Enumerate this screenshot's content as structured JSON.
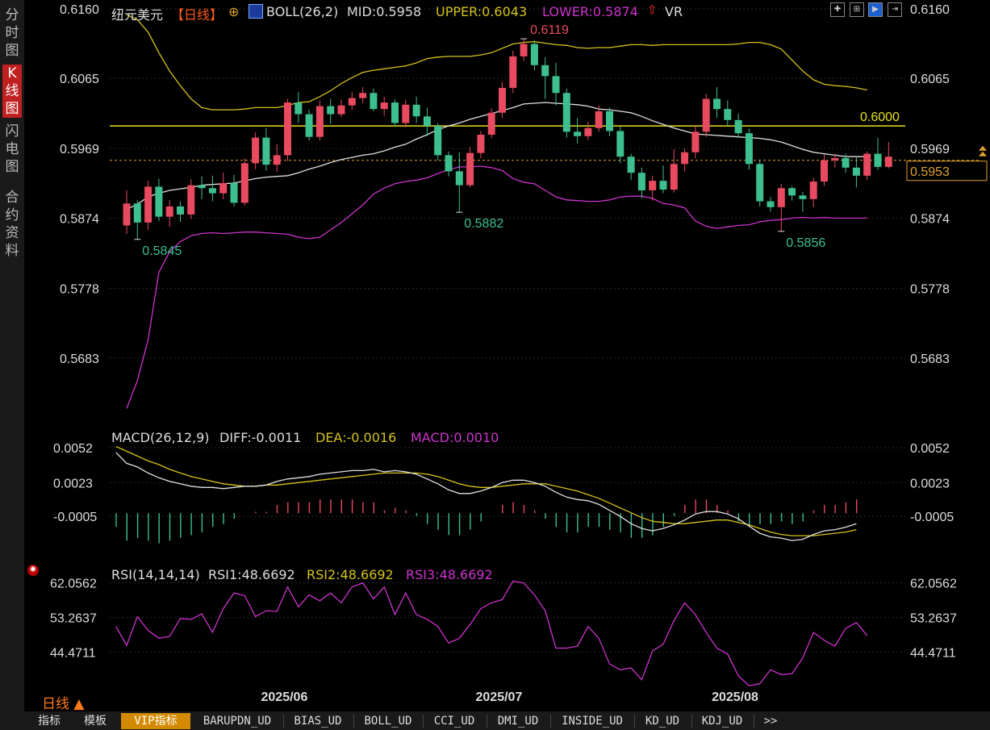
{
  "sidebar": {
    "items": [
      {
        "label": "分时图",
        "active": false
      },
      {
        "label": "K线图",
        "active": true
      },
      {
        "label": "闪电图",
        "active": false
      },
      {
        "label": "合约资料",
        "active": false
      }
    ]
  },
  "header": {
    "instrument": "纽元美元",
    "period": "【日线】",
    "add_icon": "⊕",
    "indicator": "BOLL(26,2)",
    "mid": "MID:0.5958",
    "upper": "UPPER:0.6043",
    "lower": "LOWER:0.5874",
    "vr": "VR"
  },
  "macd_header": {
    "name": "MACD(26,12,9)",
    "diff": "DIFF:-0.0011",
    "dea": "DEA:-0.0016",
    "macd": "MACD:0.0010"
  },
  "rsi_header": {
    "name": "RSI(14,14,14)",
    "rsi1": "RSI1:48.6692",
    "rsi2": "RSI2:48.6692",
    "rsi3": "RSI3:48.6692"
  },
  "period_label": "日线 ▲",
  "tabs": [
    "指标",
    "模板",
    "VIP指标",
    "BARUPDN_UD",
    "BIAS_UD",
    "BOLL_UD",
    "CCI_UD",
    "DMI_UD",
    "INSIDE_UD",
    "KD_UD",
    "KDJ_UD",
    ">>"
  ],
  "colors": {
    "up": "#e84a5f",
    "down": "#3dbf8f",
    "upper": "#d4c21a",
    "mid": "#e0e0e0",
    "lower": "#cc33cc",
    "hline": "#e8e020",
    "price_line": "#e0a030"
  },
  "chart_data": [
    {
      "type": "candlestick",
      "title": "纽元美元【日线】",
      "y_ticks": [
        "0.6160",
        "0.6065",
        "0.5969",
        "0.5874",
        "0.5778",
        "0.5683"
      ],
      "ylim": [
        0.5588,
        0.6172
      ],
      "x_labels": [
        "2025/06",
        "2025/07",
        "2025/08"
      ],
      "x_label_index": [
        15,
        35,
        57
      ],
      "annotations": {
        "high": "0.6119",
        "lows": [
          "0.5845",
          "0.5882",
          "0.5856"
        ],
        "hline": "0.6000",
        "last_price": "0.5953"
      },
      "hline": 0.6,
      "last_price": 0.5953,
      "candles": [
        [
          0.5864,
          0.5894,
          0.5912,
          0.5852
        ],
        [
          0.5894,
          0.5868,
          0.5899,
          0.5845
        ],
        [
          0.5868,
          0.5917,
          0.5925,
          0.5858
        ],
        [
          0.5917,
          0.5876,
          0.5928,
          0.587
        ],
        [
          0.5876,
          0.589,
          0.5899,
          0.5862
        ],
        [
          0.589,
          0.5879,
          0.5897,
          0.5869
        ],
        [
          0.5879,
          0.5919,
          0.5927,
          0.5873
        ],
        [
          0.5919,
          0.5915,
          0.5931,
          0.59
        ],
        [
          0.5915,
          0.5908,
          0.5932,
          0.5897
        ],
        [
          0.5908,
          0.5922,
          0.5936,
          0.59
        ],
        [
          0.5922,
          0.5895,
          0.5933,
          0.589
        ],
        [
          0.5895,
          0.5949,
          0.5956,
          0.5891
        ],
        [
          0.5949,
          0.5984,
          0.5991,
          0.5941
        ],
        [
          0.5984,
          0.5947,
          0.5997,
          0.5939
        ],
        [
          0.5947,
          0.596,
          0.5975,
          0.5937
        ],
        [
          0.596,
          0.6032,
          0.6037,
          0.5952
        ],
        [
          0.6032,
          0.6016,
          0.6046,
          0.6004
        ],
        [
          0.6016,
          0.5985,
          0.6022,
          0.598
        ],
        [
          0.5985,
          0.6027,
          0.6035,
          0.598
        ],
        [
          0.6027,
          0.6016,
          0.6037,
          0.6003
        ],
        [
          0.6016,
          0.6028,
          0.6036,
          0.6012
        ],
        [
          0.6028,
          0.6038,
          0.6046,
          0.6022
        ],
        [
          0.6038,
          0.6045,
          0.6053,
          0.6031
        ],
        [
          0.6045,
          0.6023,
          0.6051,
          0.602
        ],
        [
          0.6023,
          0.6032,
          0.604,
          0.6014
        ],
        [
          0.6032,
          0.6004,
          0.6036,
          0.5999
        ],
        [
          0.6004,
          0.6029,
          0.6036,
          0.5998
        ],
        [
          0.6029,
          0.6013,
          0.604,
          0.6004
        ],
        [
          0.6013,
          0.6,
          0.6025,
          0.5986
        ],
        [
          0.6,
          0.596,
          0.6004,
          0.5953
        ],
        [
          0.596,
          0.5938,
          0.5965,
          0.5931
        ],
        [
          0.5938,
          0.5919,
          0.5964,
          0.5882
        ],
        [
          0.5919,
          0.5963,
          0.5971,
          0.5916
        ],
        [
          0.5963,
          0.5988,
          0.5993,
          0.5956
        ],
        [
          0.5988,
          0.6018,
          0.6024,
          0.5983
        ],
        [
          0.6018,
          0.6052,
          0.606,
          0.6011
        ],
        [
          0.6052,
          0.6095,
          0.6103,
          0.6045
        ],
        [
          0.6095,
          0.6112,
          0.6119,
          0.6089
        ],
        [
          0.6112,
          0.6083,
          0.6117,
          0.6076
        ],
        [
          0.6083,
          0.6068,
          0.6094,
          0.6037
        ],
        [
          0.6068,
          0.6045,
          0.6086,
          0.6028
        ],
        [
          0.6045,
          0.5992,
          0.6051,
          0.5984
        ],
        [
          0.5992,
          0.5986,
          0.6011,
          0.5976
        ],
        [
          0.5986,
          0.5997,
          0.6006,
          0.5981
        ],
        [
          0.5997,
          0.602,
          0.6028,
          0.5992
        ],
        [
          0.602,
          0.5993,
          0.6025,
          0.5986
        ],
        [
          0.5993,
          0.5958,
          0.6,
          0.5949
        ],
        [
          0.5958,
          0.5936,
          0.5962,
          0.5926
        ],
        [
          0.5936,
          0.5912,
          0.5943,
          0.5901
        ],
        [
          0.5912,
          0.5925,
          0.5932,
          0.5898
        ],
        [
          0.5925,
          0.5913,
          0.5946,
          0.5908
        ],
        [
          0.5913,
          0.5948,
          0.5968,
          0.5909
        ],
        [
          0.5948,
          0.5964,
          0.5969,
          0.5938
        ],
        [
          0.5964,
          0.5992,
          0.6,
          0.5956
        ],
        [
          0.5992,
          0.6037,
          0.6044,
          0.5985
        ],
        [
          0.6037,
          0.6023,
          0.6053,
          0.6011
        ],
        [
          0.6023,
          0.6008,
          0.6035,
          0.6001
        ],
        [
          0.6008,
          0.599,
          0.6017,
          0.5984
        ],
        [
          0.599,
          0.5948,
          0.5996,
          0.594
        ],
        [
          0.5948,
          0.5897,
          0.5954,
          0.589
        ],
        [
          0.5897,
          0.5889,
          0.5903,
          0.5883
        ],
        [
          0.5889,
          0.5915,
          0.5921,
          0.5856
        ],
        [
          0.5915,
          0.5905,
          0.5918,
          0.5898
        ],
        [
          0.5905,
          0.59,
          0.591,
          0.5883
        ],
        [
          0.59,
          0.5924,
          0.5929,
          0.5889
        ],
        [
          0.5924,
          0.5953,
          0.5961,
          0.5918
        ],
        [
          0.5953,
          0.5956,
          0.5962,
          0.5943
        ],
        [
          0.5956,
          0.5943,
          0.5962,
          0.5936
        ],
        [
          0.5943,
          0.5932,
          0.5957,
          0.5916
        ],
        [
          0.5932,
          0.5962,
          0.5965,
          0.5926
        ],
        [
          0.5962,
          0.5944,
          0.5984,
          0.594
        ],
        [
          0.5944,
          0.5958,
          0.5978,
          0.5942
        ]
      ],
      "boll_upper": [
        0.6152,
        0.6145,
        0.6128,
        0.61,
        0.6075,
        0.6055,
        0.6037,
        0.6025,
        0.6022,
        0.6022,
        0.6022,
        0.6023,
        0.6025,
        0.6025,
        0.6025,
        0.6028,
        0.6032,
        0.6033,
        0.604,
        0.6048,
        0.6058,
        0.6066,
        0.6073,
        0.6076,
        0.6078,
        0.608,
        0.6082,
        0.6086,
        0.6092,
        0.6094,
        0.6095,
        0.6095,
        0.6095,
        0.6097,
        0.61,
        0.6106,
        0.6112,
        0.6114,
        0.6115,
        0.6113,
        0.6111,
        0.611,
        0.6107,
        0.6106,
        0.6107,
        0.6107,
        0.6109,
        0.6111,
        0.6111,
        0.611,
        0.6111,
        0.6111,
        0.6111,
        0.6111,
        0.6111,
        0.6111,
        0.6111,
        0.6112,
        0.6114,
        0.6114,
        0.6111,
        0.6105,
        0.609,
        0.6075,
        0.6063,
        0.6057,
        0.6055,
        0.6054,
        0.6052,
        0.6049
      ],
      "boll_mid": [
        0.5886,
        0.5893,
        0.5903,
        0.5908,
        0.5912,
        0.5914,
        0.5916,
        0.5919,
        0.592,
        0.5921,
        0.5922,
        0.5925,
        0.5928,
        0.593,
        0.5931,
        0.5932,
        0.5936,
        0.5941,
        0.5945,
        0.595,
        0.5954,
        0.5957,
        0.596,
        0.5962,
        0.5966,
        0.5971,
        0.5975,
        0.5982,
        0.5988,
        0.5995,
        0.6,
        0.6004,
        0.6009,
        0.6013,
        0.6017,
        0.6021,
        0.6025,
        0.603,
        0.6031,
        0.6032,
        0.6031,
        0.603,
        0.6029,
        0.6027,
        0.6023,
        0.6022,
        0.602,
        0.6018,
        0.6013,
        0.6007,
        0.6002,
        0.5997,
        0.5993,
        0.5989,
        0.5988,
        0.5987,
        0.5986,
        0.5985,
        0.5984,
        0.5983,
        0.5981,
        0.5978,
        0.5973,
        0.5968,
        0.5964,
        0.5962,
        0.596,
        0.5958,
        0.5958,
        0.5958
      ],
      "boll_lower": [
        0.5614,
        0.5652,
        0.5708,
        0.58,
        0.5828,
        0.5842,
        0.585,
        0.5853,
        0.5854,
        0.5853,
        0.5854,
        0.5855,
        0.5855,
        0.5854,
        0.5853,
        0.5852,
        0.5848,
        0.5846,
        0.5848,
        0.5858,
        0.5868,
        0.588,
        0.5892,
        0.5907,
        0.5915,
        0.5921,
        0.5924,
        0.5926,
        0.5929,
        0.5935,
        0.594,
        0.5944,
        0.5944,
        0.5945,
        0.5943,
        0.5939,
        0.5928,
        0.5923,
        0.5921,
        0.5912,
        0.5903,
        0.5899,
        0.5898,
        0.5897,
        0.5897,
        0.5899,
        0.5903,
        0.5904,
        0.5904,
        0.5901,
        0.5894,
        0.5892,
        0.5888,
        0.587,
        0.5863,
        0.586,
        0.5862,
        0.5864,
        0.5865,
        0.5869,
        0.5871,
        0.5872,
        0.5874,
        0.5875,
        0.5874,
        0.5875,
        0.5874,
        0.5874,
        0.5874,
        0.5874
      ]
    },
    {
      "type": "macd",
      "title": "MACD(26,12,9)",
      "y_ticks": [
        "0.0052",
        "0.0023",
        "-0.0005"
      ],
      "ylim": [
        -0.0045,
        0.006
      ],
      "diff": [
        0.0048,
        0.0039,
        0.0036,
        0.0031,
        0.0027,
        0.0024,
        0.0022,
        0.002,
        0.0019,
        0.0019,
        0.0018,
        0.0019,
        0.002,
        0.002,
        0.0021,
        0.0024,
        0.0026,
        0.0027,
        0.0028,
        0.003,
        0.0031,
        0.0032,
        0.0033,
        0.0033,
        0.0034,
        0.0032,
        0.0033,
        0.0032,
        0.003,
        0.0026,
        0.0022,
        0.0017,
        0.0014,
        0.0014,
        0.0016,
        0.0019,
        0.0023,
        0.0025,
        0.0025,
        0.0023,
        0.002,
        0.0015,
        0.0011,
        0.0009,
        0.0008,
        0.0005,
        0.0,
        -0.0005,
        -0.0011,
        -0.0015,
        -0.0017,
        -0.0015,
        -0.0012,
        -0.0008,
        -0.0003,
        -0.0001,
        -0.0001,
        -0.0003,
        -0.0007,
        -0.0013,
        -0.0019,
        -0.0022,
        -0.0023,
        -0.0025,
        -0.0024,
        -0.002,
        -0.0017,
        -0.0016,
        -0.0014,
        -0.0011
      ],
      "dea": [
        0.0053,
        0.0049,
        0.0045,
        0.0041,
        0.0038,
        0.0034,
        0.0031,
        0.0028,
        0.0026,
        0.0024,
        0.0022,
        0.0021,
        0.002,
        0.002,
        0.0021,
        0.0021,
        0.0022,
        0.0023,
        0.0024,
        0.0025,
        0.0026,
        0.0027,
        0.0028,
        0.0029,
        0.003,
        0.0031,
        0.0031,
        0.0031,
        0.0031,
        0.003,
        0.0028,
        0.0025,
        0.0022,
        0.002,
        0.0019,
        0.0019,
        0.002,
        0.0021,
        0.0022,
        0.0022,
        0.0022,
        0.002,
        0.0018,
        0.0016,
        0.0013,
        0.001,
        0.0006,
        0.0002,
        -0.0002,
        -0.0006,
        -0.0009,
        -0.001,
        -0.0011,
        -0.0011,
        -0.001,
        -0.0009,
        -0.0008,
        -0.0008,
        -0.001,
        -0.0012,
        -0.0015,
        -0.0018,
        -0.002,
        -0.0021,
        -0.0021,
        -0.0021,
        -0.002,
        -0.0019,
        -0.0018,
        -0.0016
      ],
      "macd": [
        -0.001,
        -0.002,
        -0.0018,
        -0.002,
        -0.0022,
        -0.002,
        -0.0018,
        -0.0016,
        -0.0014,
        -0.001,
        -0.0008,
        -0.0004,
        0.0,
        0.0001,
        0.0001,
        0.0006,
        0.0008,
        0.0008,
        0.0008,
        0.001,
        0.001,
        0.001,
        0.001,
        0.0008,
        0.0008,
        0.0002,
        0.0004,
        0.0002,
        -0.0002,
        -0.0008,
        -0.0012,
        -0.0016,
        -0.0016,
        -0.0012,
        -0.0006,
        0.0,
        0.0006,
        0.0008,
        0.0006,
        0.0002,
        -0.0004,
        -0.001,
        -0.0014,
        -0.0014,
        -0.001,
        -0.001,
        -0.0012,
        -0.0014,
        -0.0018,
        -0.0018,
        -0.0016,
        -0.001,
        -0.0002,
        0.0006,
        0.001,
        0.001,
        0.0006,
        0.0002,
        -0.0006,
        -0.001,
        -0.0008,
        -0.0008,
        -0.0006,
        -0.0008,
        -0.0006,
        0.0002,
        0.0006,
        0.0006,
        0.0008,
        0.001
      ]
    },
    {
      "type": "line",
      "title": "RSI(14,14,14)",
      "y_ticks": [
        "62.0562",
        "53.2637",
        "44.4711"
      ],
      "ylim": [
        36.0,
        63.6
      ],
      "rsi": [
        51.0,
        46.2,
        53.5,
        50.0,
        48.0,
        48.5,
        53.0,
        52.8,
        54.2,
        49.5,
        55.5,
        59.5,
        58.8,
        53.5,
        55.0,
        54.8,
        61.0,
        56.0,
        59.0,
        57.5,
        59.5,
        57.0,
        61.0,
        62.0,
        58.0,
        61.0,
        54.0,
        59.5,
        54.0,
        52.8,
        51.0,
        46.8,
        48.0,
        51.5,
        55.5,
        57.0,
        57.8,
        62.5,
        62.0,
        59.0,
        55.0,
        45.5,
        45.5,
        46.0,
        51.0,
        48.0,
        41.5,
        40.0,
        40.5,
        37.5,
        44.8,
        46.5,
        52.5,
        57.0,
        54.0,
        49.5,
        45.5,
        44.0,
        38.5,
        36.0,
        36.5,
        40.0,
        38.8,
        39.0,
        43.0,
        49.5,
        47.5,
        46.0,
        50.5,
        52.0,
        48.7
      ]
    }
  ]
}
